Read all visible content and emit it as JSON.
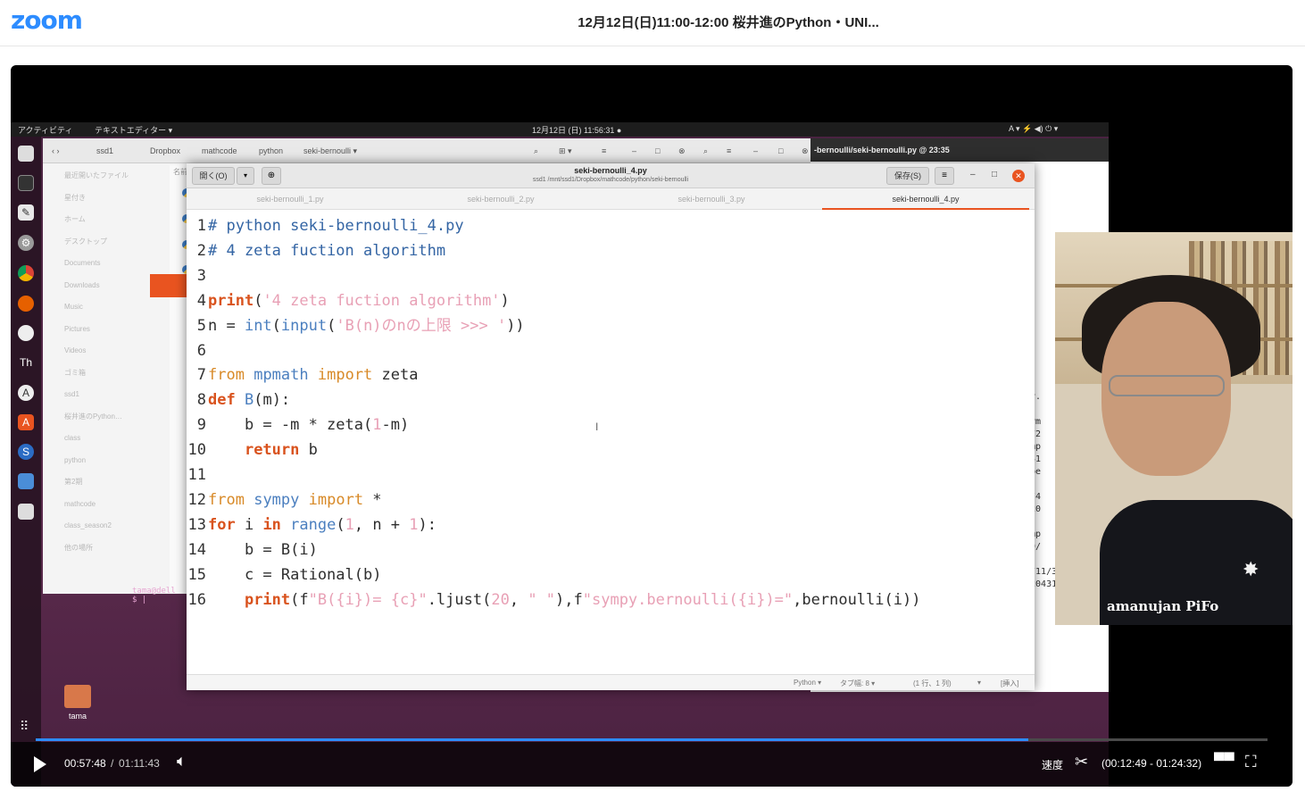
{
  "app": {
    "logo": "zoom",
    "meeting_title": "12月12日(日)11:00-12:00 桜井進のPython・UNI..."
  },
  "desktop": {
    "topbar": {
      "activities": "アクティビティ",
      "app_menu": "テキストエディター ▾",
      "clock": "12月12日 (日) 11:56:31  ●",
      "status": "A ▾   ⚡ ◀) ⏻ ▾"
    },
    "files": {
      "path": [
        "ssd1",
        "Dropbox",
        "mathcode",
        "python",
        "seki-bernoulli ▾"
      ],
      "sidebar": [
        "最近開いたファイル",
        "星付き",
        "ホーム",
        "デスクトップ",
        "Documents",
        "Downloads",
        "Music",
        "Pictures",
        "Videos",
        "ゴミ箱",
        "ssd1",
        "桜井進のPython…",
        "class",
        "python",
        "第2期",
        "mathcode",
        "class_season2",
        "他の場所"
      ],
      "column_header": "名前"
    },
    "terminal": {
      "prompt": "tama@dell",
      "cursor": "$ |"
    },
    "home_folder_label": "tama",
    "back_editor_title": "-bernoulli/seki-bernoulli.py  @  23:35",
    "back_editor_lines": [
      "py.",
      "",
      "sym",
      "272",
      "ymp",
      "141",
      ".be",
      "",
      "9/4",
      "420",
      "",
      "ymp",
      "39/",
      "",
      "7711/33",
      "6204311"
    ]
  },
  "editor": {
    "open_button": "開く(O)",
    "save_button": "保存(S)",
    "title": "seki-bernoulli_4.py",
    "path": "ssd1 /mnt/ssd1/Dropbox/mathcode/python/seki-bernoulli",
    "tabs": [
      {
        "label": "seki-bernoulli_1.py",
        "active": false
      },
      {
        "label": "seki-bernoulli_2.py",
        "active": false
      },
      {
        "label": "seki-bernoulli_3.py",
        "active": false
      },
      {
        "label": "seki-bernoulli_4.py",
        "active": true
      }
    ],
    "status": {
      "language": "Python ▾",
      "tab_width": "タブ幅: 8 ▾",
      "position": "(1 行、1 列)",
      "mode": "[挿入]"
    },
    "lines": [
      {
        "n": "1",
        "tokens": [
          [
            "cm",
            "# python seki-bernoulli_4.py"
          ]
        ]
      },
      {
        "n": "2",
        "tokens": [
          [
            "cm",
            "# 4 zeta fuction algorithm"
          ]
        ]
      },
      {
        "n": "3",
        "tokens": []
      },
      {
        "n": "4",
        "tokens": [
          [
            "kw",
            "print"
          ],
          [
            "",
            "("
          ],
          [
            "st",
            "'4 zeta fuction algorithm'"
          ],
          [
            "",
            ")"
          ]
        ]
      },
      {
        "n": "5",
        "tokens": [
          [
            "",
            "n = "
          ],
          [
            "bi",
            "int"
          ],
          [
            "",
            "("
          ],
          [
            "bi",
            "input"
          ],
          [
            "",
            "("
          ],
          [
            "st",
            "'B(n)のnの上限 >>> '"
          ],
          [
            "",
            "))"
          ]
        ]
      },
      {
        "n": "6",
        "tokens": []
      },
      {
        "n": "7",
        "tokens": [
          [
            "ok",
            "from"
          ],
          [
            "",
            " "
          ],
          [
            "bi",
            "mpmath"
          ],
          [
            "",
            " "
          ],
          [
            "ok",
            "import"
          ],
          [
            "",
            " zeta"
          ]
        ]
      },
      {
        "n": "8",
        "tokens": [
          [
            "kw",
            "def"
          ],
          [
            "",
            " "
          ],
          [
            "bi",
            "B"
          ],
          [
            "",
            "(m):"
          ]
        ]
      },
      {
        "n": "9",
        "tokens": [
          [
            "",
            "    b = -m * zeta("
          ],
          [
            "num",
            "1"
          ],
          [
            "",
            "-m)"
          ]
        ]
      },
      {
        "n": "10",
        "tokens": [
          [
            "",
            "    "
          ],
          [
            "kw",
            "return"
          ],
          [
            "",
            " b"
          ]
        ]
      },
      {
        "n": "11",
        "tokens": []
      },
      {
        "n": "12",
        "tokens": [
          [
            "ok",
            "from"
          ],
          [
            "",
            " "
          ],
          [
            "bi",
            "sympy"
          ],
          [
            "",
            " "
          ],
          [
            "ok",
            "import"
          ],
          [
            "",
            " *"
          ]
        ]
      },
      {
        "n": "13",
        "tokens": [
          [
            "kw",
            "for"
          ],
          [
            "",
            " i "
          ],
          [
            "kw",
            "in"
          ],
          [
            "",
            " "
          ],
          [
            "bi",
            "range"
          ],
          [
            "",
            "("
          ],
          [
            "num",
            "1"
          ],
          [
            "",
            ", n + "
          ],
          [
            "num",
            "1"
          ],
          [
            "",
            "):"
          ]
        ]
      },
      {
        "n": "14",
        "tokens": [
          [
            "",
            "    b = B(i)"
          ]
        ]
      },
      {
        "n": "15",
        "tokens": [
          [
            "",
            "    c = Rational(b)"
          ]
        ]
      },
      {
        "n": "16",
        "tokens": [
          [
            "",
            "    "
          ],
          [
            "kw",
            "print"
          ],
          [
            "",
            "(f"
          ],
          [
            "st",
            "\"B({i})= {c}\""
          ],
          [
            "",
            ".ljust("
          ],
          [
            "num",
            "20"
          ],
          [
            "",
            ", "
          ],
          [
            "st",
            "\" \""
          ],
          [
            "",
            "),f"
          ],
          [
            "st",
            "\"sympy.bernoulli({i})=\""
          ],
          [
            "",
            ",bernoulli(i))"
          ]
        ]
      }
    ]
  },
  "webcam": {
    "shirt_text": "amanujan PiFo"
  },
  "player": {
    "current_time": "00:57:48",
    "separator": "/",
    "total_time": "01:11:43",
    "progress_fraction": 0.806,
    "speed_label": "速度",
    "clip_range": "(00:12:49 - 01:24:32)"
  },
  "icons": {
    "play": "play-icon",
    "volume": "volume-icon",
    "clip": "scissors-icon",
    "layout": "layout-icon",
    "fullscreen": "fullscreen-icon"
  },
  "colors": {
    "zoom_blue": "#2D8CFF",
    "ubuntu_orange": "#E95420",
    "keyword": "#D9531E",
    "comment": "#3465A4",
    "string": "#E8A0B5"
  }
}
